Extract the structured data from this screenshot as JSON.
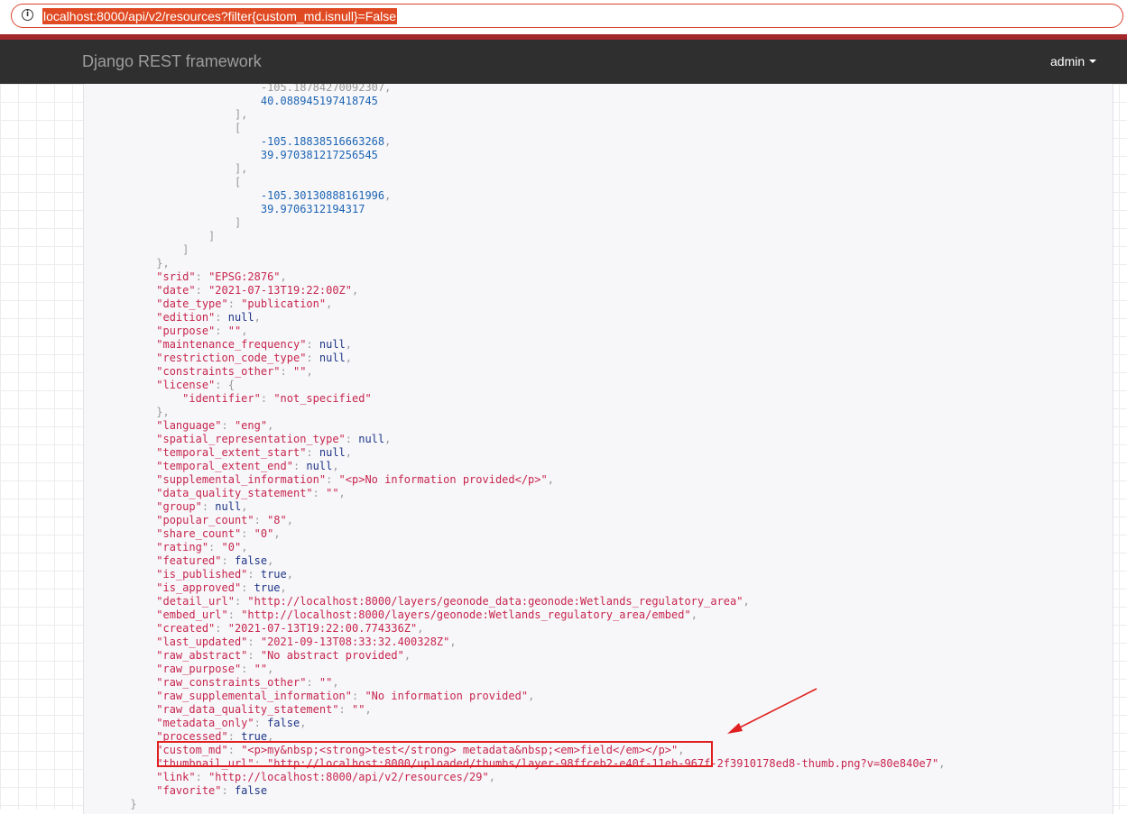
{
  "browser": {
    "url": "localhost:8000/api/v2/resources?filter{custom_md.isnull}=False"
  },
  "navbar": {
    "brand": "Django REST framework",
    "user": "admin"
  },
  "json_lines": [
    {
      "indent": 26,
      "parts": [
        [
          "p",
          "-105.18784270092307,"
        ]
      ]
    },
    {
      "indent": 26,
      "parts": [
        [
          "n",
          "40.088945197418745"
        ]
      ]
    },
    {
      "indent": 22,
      "parts": [
        [
          "p",
          "],"
        ]
      ]
    },
    {
      "indent": 22,
      "parts": [
        [
          "p",
          "["
        ]
      ]
    },
    {
      "indent": 26,
      "parts": [
        [
          "n",
          "-105.18838516663268"
        ],
        [
          "p",
          ","
        ]
      ]
    },
    {
      "indent": 26,
      "parts": [
        [
          "n",
          "39.970381217256545"
        ]
      ]
    },
    {
      "indent": 22,
      "parts": [
        [
          "p",
          "],"
        ]
      ]
    },
    {
      "indent": 22,
      "parts": [
        [
          "p",
          "["
        ]
      ]
    },
    {
      "indent": 26,
      "parts": [
        [
          "n",
          "-105.30130888161996"
        ],
        [
          "p",
          ","
        ]
      ]
    },
    {
      "indent": 26,
      "parts": [
        [
          "n",
          "39.9706312194317"
        ]
      ]
    },
    {
      "indent": 22,
      "parts": [
        [
          "p",
          "]"
        ]
      ]
    },
    {
      "indent": 18,
      "parts": [
        [
          "p",
          "]"
        ]
      ]
    },
    {
      "indent": 14,
      "parts": [
        [
          "p",
          "]"
        ]
      ]
    },
    {
      "indent": 10,
      "parts": [
        [
          "p",
          "},"
        ]
      ]
    },
    {
      "indent": 10,
      "parts": [
        [
          "k",
          "\"srid\""
        ],
        [
          "p",
          ": "
        ],
        [
          "s",
          "\"EPSG:2876\""
        ],
        [
          "p",
          ","
        ]
      ]
    },
    {
      "indent": 10,
      "parts": [
        [
          "k",
          "\"date\""
        ],
        [
          "p",
          ": "
        ],
        [
          "s",
          "\"2021-07-13T19:22:00Z\""
        ],
        [
          "p",
          ","
        ]
      ]
    },
    {
      "indent": 10,
      "parts": [
        [
          "k",
          "\"date_type\""
        ],
        [
          "p",
          ": "
        ],
        [
          "s",
          "\"publication\""
        ],
        [
          "p",
          ","
        ]
      ]
    },
    {
      "indent": 10,
      "parts": [
        [
          "k",
          "\"edition\""
        ],
        [
          "p",
          ": "
        ],
        [
          "l",
          "null"
        ],
        [
          "p",
          ","
        ]
      ]
    },
    {
      "indent": 10,
      "parts": [
        [
          "k",
          "\"purpose\""
        ],
        [
          "p",
          ": "
        ],
        [
          "s",
          "\"\""
        ],
        [
          "p",
          ","
        ]
      ]
    },
    {
      "indent": 10,
      "parts": [
        [
          "k",
          "\"maintenance_frequency\""
        ],
        [
          "p",
          ": "
        ],
        [
          "l",
          "null"
        ],
        [
          "p",
          ","
        ]
      ]
    },
    {
      "indent": 10,
      "parts": [
        [
          "k",
          "\"restriction_code_type\""
        ],
        [
          "p",
          ": "
        ],
        [
          "l",
          "null"
        ],
        [
          "p",
          ","
        ]
      ]
    },
    {
      "indent": 10,
      "parts": [
        [
          "k",
          "\"constraints_other\""
        ],
        [
          "p",
          ": "
        ],
        [
          "s",
          "\"\""
        ],
        [
          "p",
          ","
        ]
      ]
    },
    {
      "indent": 10,
      "parts": [
        [
          "k",
          "\"license\""
        ],
        [
          "p",
          ": {"
        ]
      ]
    },
    {
      "indent": 14,
      "parts": [
        [
          "k",
          "\"identifier\""
        ],
        [
          "p",
          ": "
        ],
        [
          "s",
          "\"not_specified\""
        ]
      ]
    },
    {
      "indent": 10,
      "parts": [
        [
          "p",
          "},"
        ]
      ]
    },
    {
      "indent": 10,
      "parts": [
        [
          "k",
          "\"language\""
        ],
        [
          "p",
          ": "
        ],
        [
          "s",
          "\"eng\""
        ],
        [
          "p",
          ","
        ]
      ]
    },
    {
      "indent": 10,
      "parts": [
        [
          "k",
          "\"spatial_representation_type\""
        ],
        [
          "p",
          ": "
        ],
        [
          "l",
          "null"
        ],
        [
          "p",
          ","
        ]
      ]
    },
    {
      "indent": 10,
      "parts": [
        [
          "k",
          "\"temporal_extent_start\""
        ],
        [
          "p",
          ": "
        ],
        [
          "l",
          "null"
        ],
        [
          "p",
          ","
        ]
      ]
    },
    {
      "indent": 10,
      "parts": [
        [
          "k",
          "\"temporal_extent_end\""
        ],
        [
          "p",
          ": "
        ],
        [
          "l",
          "null"
        ],
        [
          "p",
          ","
        ]
      ]
    },
    {
      "indent": 10,
      "parts": [
        [
          "k",
          "\"supplemental_information\""
        ],
        [
          "p",
          ": "
        ],
        [
          "s",
          "\"<p>No information provided</p>\""
        ],
        [
          "p",
          ","
        ]
      ]
    },
    {
      "indent": 10,
      "parts": [
        [
          "k",
          "\"data_quality_statement\""
        ],
        [
          "p",
          ": "
        ],
        [
          "s",
          "\"\""
        ],
        [
          "p",
          ","
        ]
      ]
    },
    {
      "indent": 10,
      "parts": [
        [
          "k",
          "\"group\""
        ],
        [
          "p",
          ": "
        ],
        [
          "l",
          "null"
        ],
        [
          "p",
          ","
        ]
      ]
    },
    {
      "indent": 10,
      "parts": [
        [
          "k",
          "\"popular_count\""
        ],
        [
          "p",
          ": "
        ],
        [
          "s",
          "\"8\""
        ],
        [
          "p",
          ","
        ]
      ]
    },
    {
      "indent": 10,
      "parts": [
        [
          "k",
          "\"share_count\""
        ],
        [
          "p",
          ": "
        ],
        [
          "s",
          "\"0\""
        ],
        [
          "p",
          ","
        ]
      ]
    },
    {
      "indent": 10,
      "parts": [
        [
          "k",
          "\"rating\""
        ],
        [
          "p",
          ": "
        ],
        [
          "s",
          "\"0\""
        ],
        [
          "p",
          ","
        ]
      ]
    },
    {
      "indent": 10,
      "parts": [
        [
          "k",
          "\"featured\""
        ],
        [
          "p",
          ": "
        ],
        [
          "l",
          "false"
        ],
        [
          "p",
          ","
        ]
      ]
    },
    {
      "indent": 10,
      "parts": [
        [
          "k",
          "\"is_published\""
        ],
        [
          "p",
          ": "
        ],
        [
          "l",
          "true"
        ],
        [
          "p",
          ","
        ]
      ]
    },
    {
      "indent": 10,
      "parts": [
        [
          "k",
          "\"is_approved\""
        ],
        [
          "p",
          ": "
        ],
        [
          "l",
          "true"
        ],
        [
          "p",
          ","
        ]
      ]
    },
    {
      "indent": 10,
      "parts": [
        [
          "k",
          "\"detail_url\""
        ],
        [
          "p",
          ": "
        ],
        [
          "s",
          "\"http://localhost:8000/layers/geonode_data:geonode:Wetlands_regulatory_area\""
        ],
        [
          "p",
          ","
        ]
      ]
    },
    {
      "indent": 10,
      "parts": [
        [
          "k",
          "\"embed_url\""
        ],
        [
          "p",
          ": "
        ],
        [
          "s",
          "\"http://localhost:8000/layers/geonode:Wetlands_regulatory_area/embed\""
        ],
        [
          "p",
          ","
        ]
      ]
    },
    {
      "indent": 10,
      "parts": [
        [
          "k",
          "\"created\""
        ],
        [
          "p",
          ": "
        ],
        [
          "s",
          "\"2021-07-13T19:22:00.774336Z\""
        ],
        [
          "p",
          ","
        ]
      ]
    },
    {
      "indent": 10,
      "parts": [
        [
          "k",
          "\"last_updated\""
        ],
        [
          "p",
          ": "
        ],
        [
          "s",
          "\"2021-09-13T08:33:32.400328Z\""
        ],
        [
          "p",
          ","
        ]
      ]
    },
    {
      "indent": 10,
      "parts": [
        [
          "k",
          "\"raw_abstract\""
        ],
        [
          "p",
          ": "
        ],
        [
          "s",
          "\"No abstract provided\""
        ],
        [
          "p",
          ","
        ]
      ]
    },
    {
      "indent": 10,
      "parts": [
        [
          "k",
          "\"raw_purpose\""
        ],
        [
          "p",
          ": "
        ],
        [
          "s",
          "\"\""
        ],
        [
          "p",
          ","
        ]
      ]
    },
    {
      "indent": 10,
      "parts": [
        [
          "k",
          "\"raw_constraints_other\""
        ],
        [
          "p",
          ": "
        ],
        [
          "s",
          "\"\""
        ],
        [
          "p",
          ","
        ]
      ]
    },
    {
      "indent": 10,
      "parts": [
        [
          "k",
          "\"raw_supplemental_information\""
        ],
        [
          "p",
          ": "
        ],
        [
          "s",
          "\"No information provided\""
        ],
        [
          "p",
          ","
        ]
      ]
    },
    {
      "indent": 10,
      "parts": [
        [
          "k",
          "\"raw_data_quality_statement\""
        ],
        [
          "p",
          ": "
        ],
        [
          "s",
          "\"\""
        ],
        [
          "p",
          ","
        ]
      ]
    },
    {
      "indent": 10,
      "parts": [
        [
          "k",
          "\"metadata_only\""
        ],
        [
          "p",
          ": "
        ],
        [
          "l",
          "false"
        ],
        [
          "p",
          ","
        ]
      ]
    },
    {
      "indent": 10,
      "parts": [
        [
          "k",
          "\"processed\""
        ],
        [
          "p",
          ": "
        ],
        [
          "l",
          "true"
        ],
        [
          "p",
          ","
        ]
      ]
    },
    {
      "indent": 10,
      "parts": [
        [
          "k",
          "\"custom_md\""
        ],
        [
          "p",
          ": "
        ],
        [
          "s",
          "\"<p>my&nbsp;<strong>test</strong> metadata&nbsp;<em>field</em></p>\""
        ],
        [
          "p",
          ","
        ]
      ]
    },
    {
      "indent": 10,
      "parts": [
        [
          "k",
          "\"thumbnail_url\""
        ],
        [
          "p",
          ": "
        ],
        [
          "s",
          "\"http://localhost:8000/uploaded/thumbs/layer-98ffceb2-e40f-11eb-967f-2f3910178ed8-thumb.png?v=80e840e7\""
        ],
        [
          "p",
          ","
        ]
      ]
    },
    {
      "indent": 10,
      "parts": [
        [
          "k",
          "\"link\""
        ],
        [
          "p",
          ": "
        ],
        [
          "s",
          "\"http://localhost:8000/api/v2/resources/29\""
        ],
        [
          "p",
          ","
        ]
      ]
    },
    {
      "indent": 10,
      "parts": [
        [
          "k",
          "\"favorite\""
        ],
        [
          "p",
          ": "
        ],
        [
          "l",
          "false"
        ]
      ]
    },
    {
      "indent": 6,
      "parts": [
        [
          "p",
          "}"
        ]
      ]
    }
  ],
  "colors": {
    "accent": "#e02020",
    "navbar": "#2f2f2f",
    "string": "#c7254e",
    "number": "#1d64b3",
    "literal": "#1e3487"
  }
}
